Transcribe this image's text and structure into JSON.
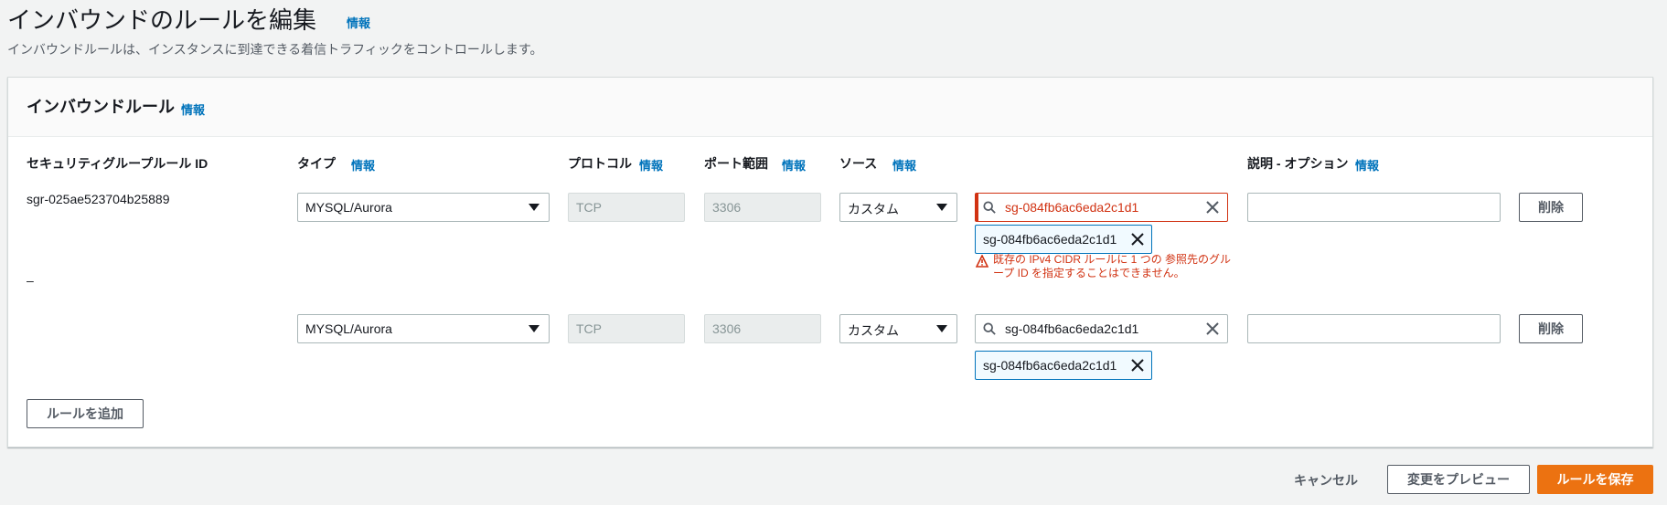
{
  "page": {
    "title": "インバウンドのルールを編集",
    "info": "情報",
    "description": "インバウンドルールは、インスタンスに到達できる着信トラフィックをコントロールします。"
  },
  "panel": {
    "title": "インバウンドルール",
    "info": "情報",
    "columns": {
      "rule_id": "セキュリティグループルール ID",
      "type": "タイプ",
      "protocol": "プロトコル",
      "port_range": "ポート範囲",
      "source": "ソース",
      "description": "説明 - オプション",
      "info": "情報"
    },
    "rules": [
      {
        "id": "sgr-025ae523704b25889",
        "type": "MYSQL/Aurora",
        "protocol": "TCP",
        "port": "3306",
        "source_type": "カスタム",
        "source_search": "sg-084fb6ac6eda2c1d1",
        "source_token": "sg-084fb6ac6eda2c1d1",
        "error_line1": "既存の IPv4 CIDR ルールに 1 つの 参照先のグル",
        "error_line2": "ープ ID を指定することはできません。",
        "description": "",
        "delete_label": "削除"
      },
      {
        "id": "–",
        "type": "MYSQL/Aurora",
        "protocol": "TCP",
        "port": "3306",
        "source_type": "カスタム",
        "source_search": "sg-084fb6ac6eda2c1d1",
        "source_token": "sg-084fb6ac6eda2c1d1",
        "description": "",
        "delete_label": "削除"
      }
    ],
    "add_rule_label": "ルールを追加"
  },
  "footer": {
    "cancel_label": "キャンセル",
    "preview_label": "変更をプレビュー",
    "save_label": "ルールを保存"
  },
  "colors": {
    "primary": "#ec7211",
    "link": "#0073bb",
    "error": "#d13212"
  },
  "icons": [
    "search-icon",
    "close-icon",
    "warning-icon",
    "caret-down-icon"
  ]
}
